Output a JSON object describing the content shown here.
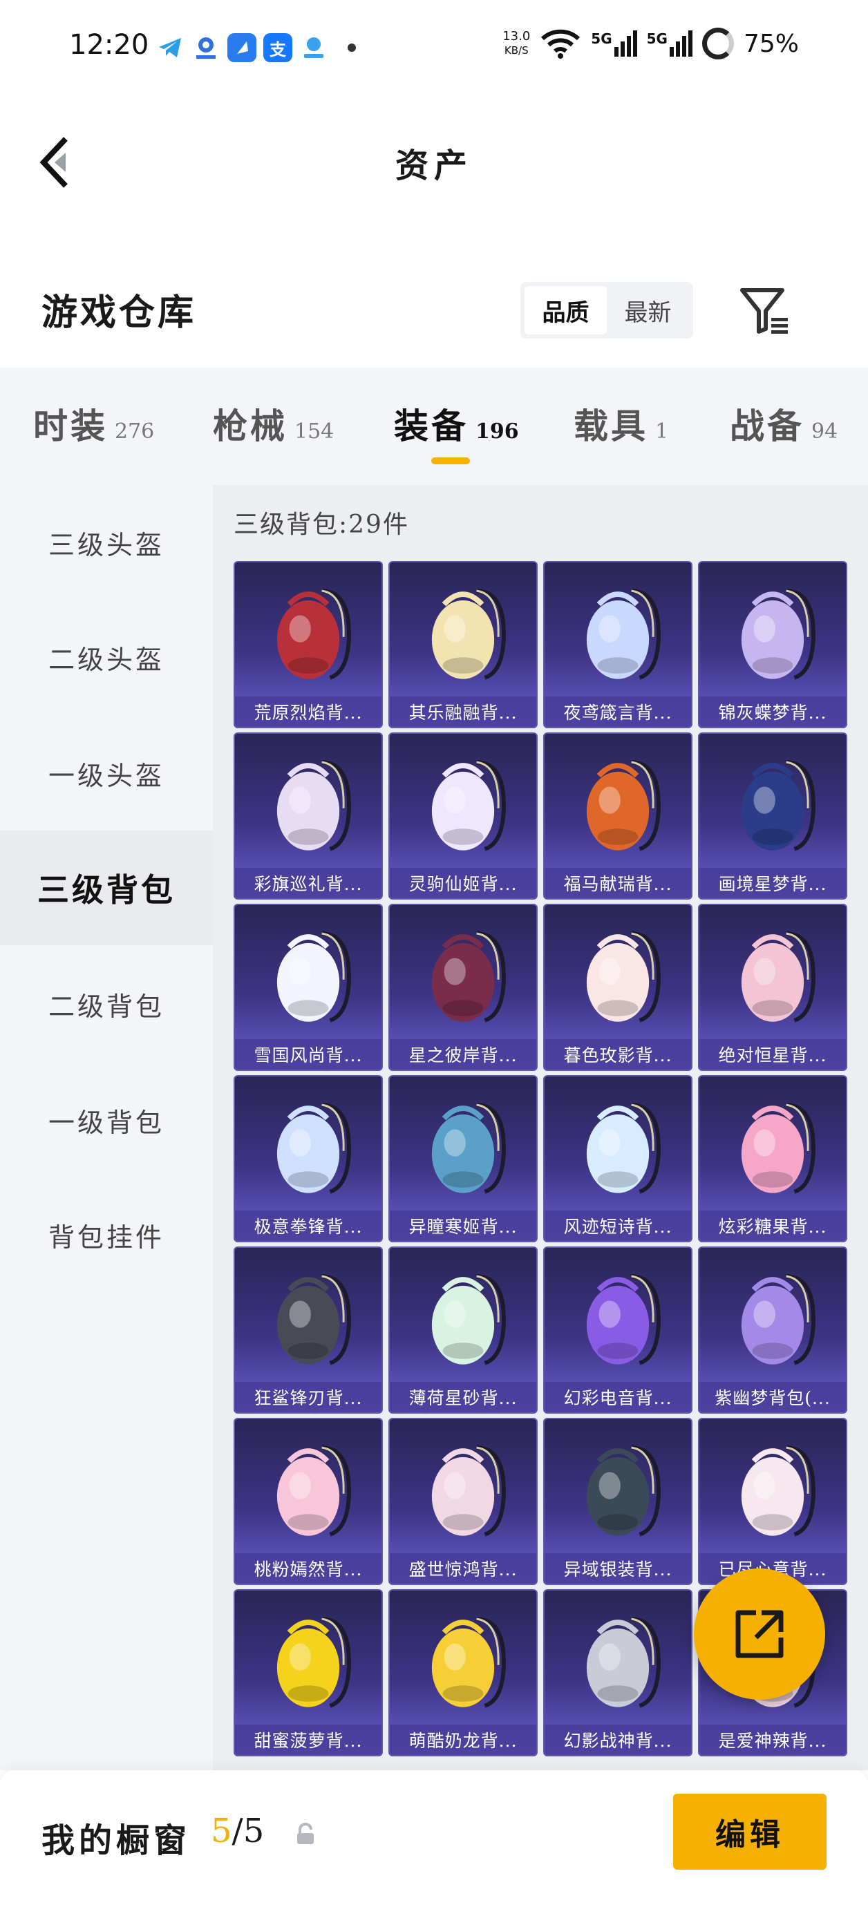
{
  "status_bar": {
    "time": "12:20",
    "net_speed_value": "13.0",
    "net_speed_unit": "KB/S",
    "signal_1": "5G",
    "signal_2": "5G",
    "battery": "75%",
    "icons": [
      "telegram-icon",
      "app-blue-icon",
      "bell-app-icon",
      "alipay-icon",
      "cloud-app-icon"
    ]
  },
  "header": {
    "title": "资产"
  },
  "warehouse": {
    "title": "游戏仓库",
    "sort_options": [
      {
        "label": "品质",
        "active": true
      },
      {
        "label": "最新",
        "active": false
      }
    ]
  },
  "category_tabs": [
    {
      "label": "时装",
      "count": "276",
      "active": false
    },
    {
      "label": "枪械",
      "count": "154",
      "active": false
    },
    {
      "label": "装备",
      "count": "196",
      "active": true
    },
    {
      "label": "载具",
      "count": "1",
      "active": false
    },
    {
      "label": "战备",
      "count": "94",
      "active": false
    }
  ],
  "side_nav": [
    {
      "label": "三级头盔",
      "active": false
    },
    {
      "label": "二级头盔",
      "active": false
    },
    {
      "label": "一级头盔",
      "active": false
    },
    {
      "label": "三级背包",
      "active": true
    },
    {
      "label": "二级背包",
      "active": false
    },
    {
      "label": "一级背包",
      "active": false
    },
    {
      "label": "背包挂件",
      "active": false
    }
  ],
  "grid": {
    "header": "三级背包:29件",
    "items": [
      {
        "name": "荒原烈焰背...",
        "color": "#b8303a"
      },
      {
        "name": "其乐融融背...",
        "color": "#f3e3b0"
      },
      {
        "name": "夜鸢箴言背...",
        "color": "#c8d8ff"
      },
      {
        "name": "锦灰蝶梦背...",
        "color": "#c6b5f0"
      },
      {
        "name": "彩旗巡礼背...",
        "color": "#e8dcf4"
      },
      {
        "name": "灵驹仙姬背...",
        "color": "#efe6ff"
      },
      {
        "name": "福马献瑞背...",
        "color": "#e0672a"
      },
      {
        "name": "画境星梦背...",
        "color": "#2b3d8a"
      },
      {
        "name": "雪国风尚背...",
        "color": "#f4f4ff"
      },
      {
        "name": "星之彼岸背...",
        "color": "#7a2d4a"
      },
      {
        "name": "暮色玫影背...",
        "color": "#fbe6e6"
      },
      {
        "name": "绝对恒星背...",
        "color": "#f2c4d4"
      },
      {
        "name": "极意拳锋背...",
        "color": "#cfe0ff"
      },
      {
        "name": "异瞳寒姬背...",
        "color": "#5aa0c8"
      },
      {
        "name": "风迹短诗背...",
        "color": "#d7ecff"
      },
      {
        "name": "炫彩糖果背...",
        "color": "#f6a7c7"
      },
      {
        "name": "狂鲨锋刃背...",
        "color": "#4a4a56"
      },
      {
        "name": "薄荷星砂背...",
        "color": "#d8f3e2"
      },
      {
        "name": "幻彩电音背...",
        "color": "#8a5ce6"
      },
      {
        "name": "紫幽梦背包(...",
        "color": "#a48ae8"
      },
      {
        "name": "桃粉嫣然背...",
        "color": "#f8c6d8"
      },
      {
        "name": "盛世惊鸿背...",
        "color": "#f1d8e4"
      },
      {
        "name": "异域银装背...",
        "color": "#3b4a58"
      },
      {
        "name": "已尽心意背...",
        "color": "#f6e8ee"
      },
      {
        "name": "甜蜜菠萝背...",
        "color": "#f5d21c"
      },
      {
        "name": "萌酷奶龙背...",
        "color": "#f6cf37"
      },
      {
        "name": "幻影战神背...",
        "color": "#c9cbd6"
      },
      {
        "name": "是爱神辣背...",
        "color": "#f3d6e2"
      }
    ]
  },
  "bottom_bar": {
    "label": "我的橱窗",
    "count_current": "5",
    "count_sep_total": "/5",
    "edit_label": "编辑"
  },
  "colors": {
    "accent": "#f6b100",
    "card_top": "#2a2556",
    "card_bottom": "#6a5fd0"
  }
}
